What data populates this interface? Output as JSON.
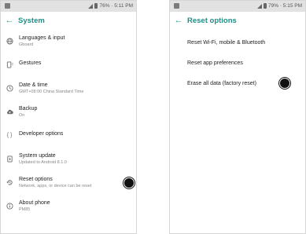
{
  "left": {
    "status": {
      "text": "76% · 5:11 PM"
    },
    "title": "System",
    "items": [
      {
        "label": "Languages & input",
        "sub": "Gboard",
        "icon": "globe-icon"
      },
      {
        "label": "Gestures",
        "sub": "",
        "icon": "gesture-phone-icon"
      },
      {
        "label": "Date & time",
        "sub": "GMT+08:00 China Standard Time",
        "icon": "clock-icon"
      },
      {
        "label": "Backup",
        "sub": "On",
        "icon": "cloud-upload-icon"
      },
      {
        "label": "Developer options",
        "sub": "",
        "icon": "code-braces-icon"
      },
      {
        "label": "System update",
        "sub": "Updated to Android 8.1.0",
        "icon": "system-update-icon"
      },
      {
        "label": "Reset options",
        "sub": "Network, apps, or device can be reset",
        "icon": "history-icon"
      },
      {
        "label": "About phone",
        "sub": "PM85",
        "icon": "info-icon"
      }
    ]
  },
  "right": {
    "status": {
      "text": "79% · 5:15 PM"
    },
    "title": "Reset options",
    "items": [
      {
        "label": "Reset Wi-Fi, mobile & Bluetooth"
      },
      {
        "label": "Reset app preferences"
      },
      {
        "label": "Erase all data (factory reset)"
      }
    ]
  }
}
